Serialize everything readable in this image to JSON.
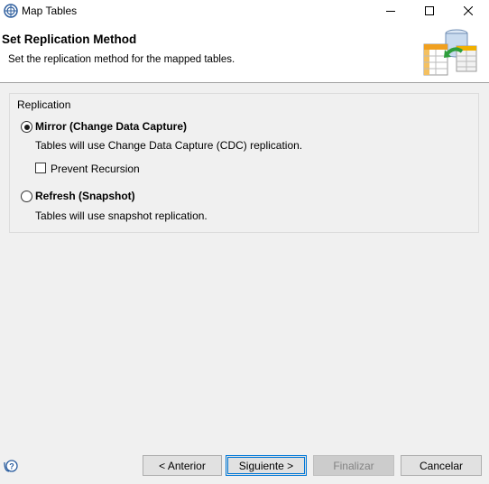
{
  "window": {
    "title": "Map Tables",
    "icon": "map-tables-icon"
  },
  "banner": {
    "title": "Set Replication Method",
    "description": "Set the replication method for the mapped tables.",
    "graphic": "database-tables-graphic"
  },
  "replication": {
    "group_label": "Replication",
    "mirror": {
      "label": "Mirror (Change Data Capture)",
      "description": "Tables will use Change Data Capture (CDC) replication.",
      "selected": true,
      "prevent_recursion": {
        "label": "Prevent Recursion",
        "checked": false
      }
    },
    "refresh": {
      "label": "Refresh (Snapshot)",
      "description": "Tables will use snapshot replication.",
      "selected": false
    }
  },
  "buttons": {
    "back": "< Anterior",
    "next": "Siguiente >",
    "finish": "Finalizar",
    "cancel": "Cancelar"
  },
  "colors": {
    "focus_border": "#0078d7",
    "dialog_bg": "#f0f0f0"
  }
}
